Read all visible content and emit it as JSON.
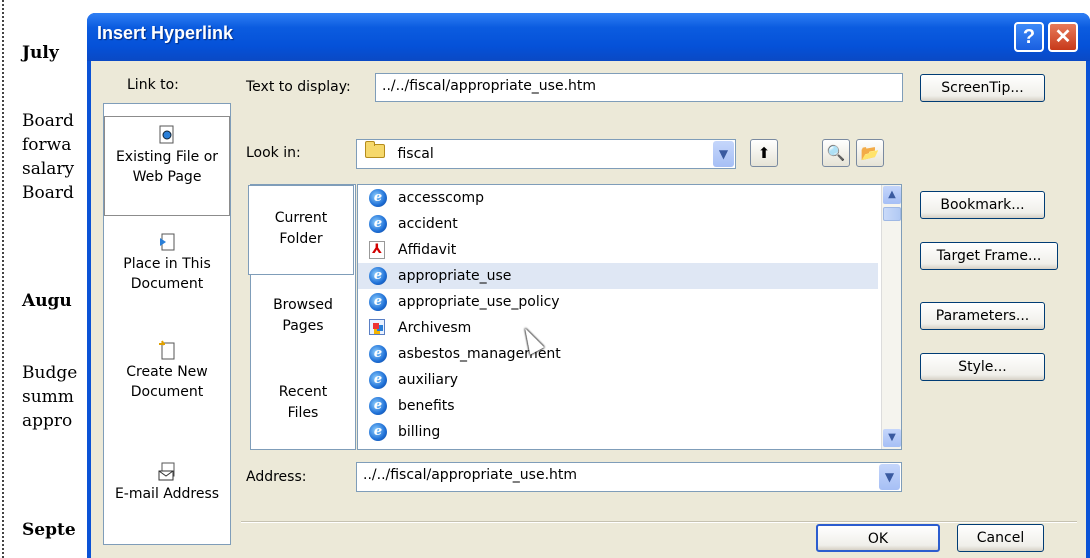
{
  "document": {
    "lines": [
      "July",
      "Board",
      "forwa",
      "salary",
      "Board",
      "Augu",
      "Budge",
      "summ",
      "appro",
      "Septe"
    ]
  },
  "dialog": {
    "title": "Insert Hyperlink",
    "help_btn": "?",
    "close_btn": "✕",
    "link_to_label": "Link to:",
    "link_items": [
      {
        "line1": "Existing File or",
        "line2": "Web Page"
      },
      {
        "line1": "Place in This",
        "line2": "Document"
      },
      {
        "line1": "Create New",
        "line2": "Document"
      },
      {
        "line1": "E-mail Address",
        "line2": ""
      }
    ],
    "text_to_display_label": "Text to display:",
    "text_to_display_value": "../../fiscal/appropriate_use.htm",
    "screentip_btn": "ScreenTip...",
    "look_in_label": "Look in:",
    "look_in_value": "fiscal",
    "tabs": [
      {
        "line1": "Current",
        "line2": "Folder"
      },
      {
        "line1": "Browsed",
        "line2": "Pages"
      },
      {
        "line1": "Recent",
        "line2": "Files"
      }
    ],
    "files": [
      "accesscomp",
      "accident",
      "Affidavit",
      "appropriate_use",
      "appropriate_use_policy",
      "Archivesm",
      "asbestos_management",
      "auxiliary",
      "benefits",
      "billing"
    ],
    "right_buttons": [
      "Bookmark...",
      "Target Frame...",
      "Parameters...",
      "Style..."
    ],
    "address_label": "Address:",
    "address_value": "../../fiscal/appropriate_use.htm",
    "ok_btn": "OK",
    "cancel_btn": "Cancel"
  }
}
